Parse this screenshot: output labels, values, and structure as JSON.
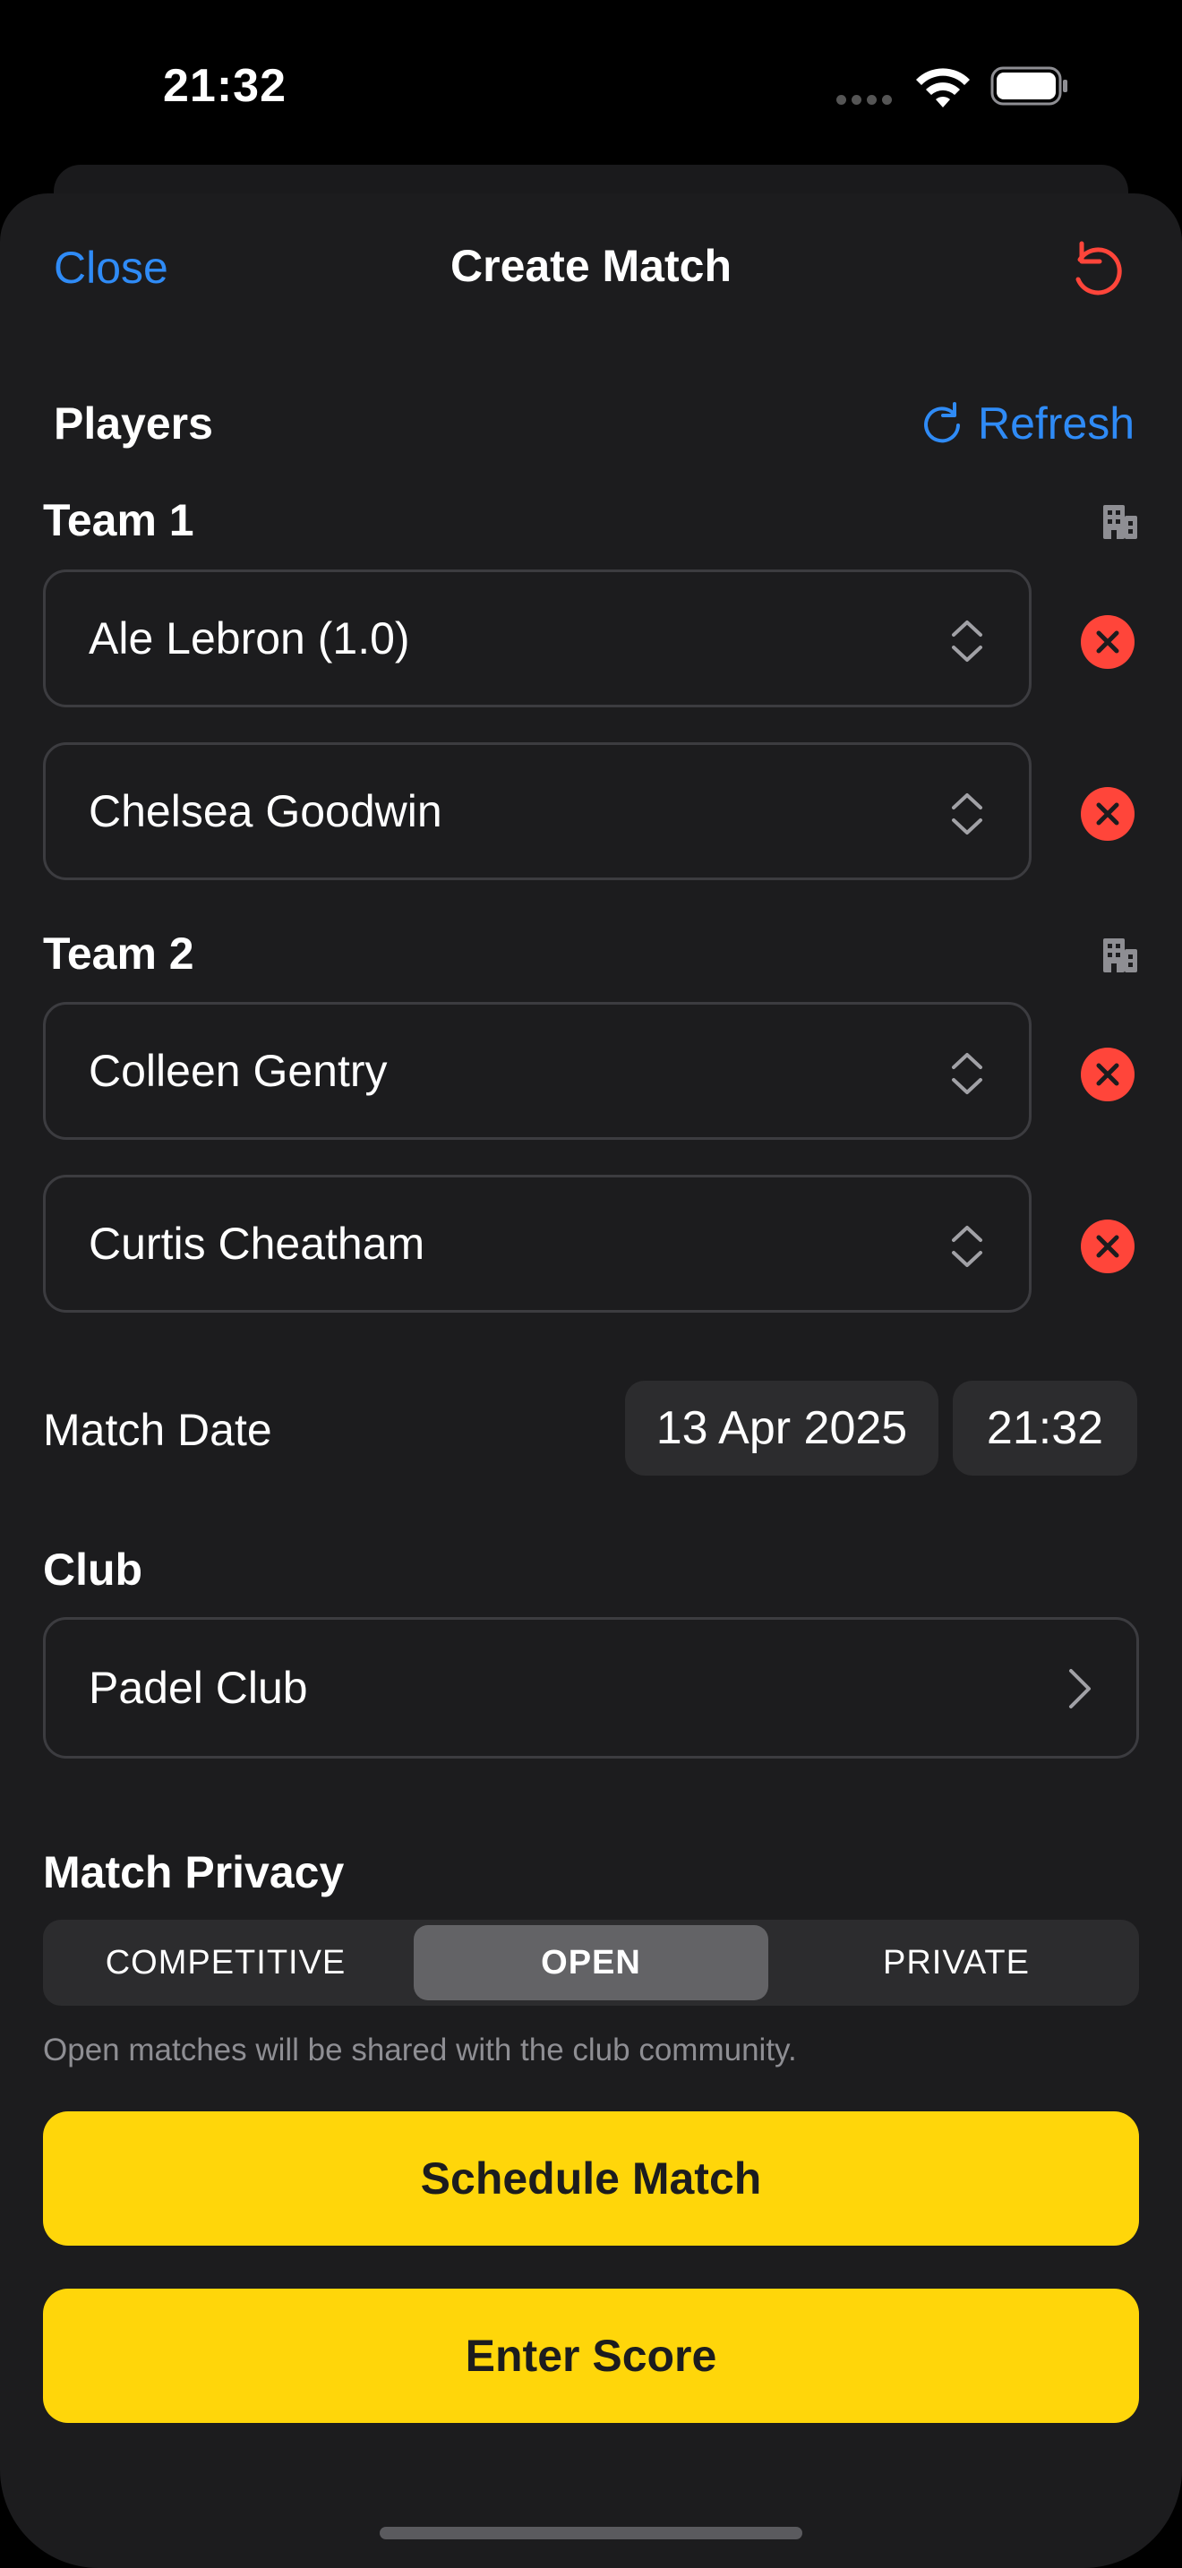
{
  "status_bar": {
    "time": "21:32"
  },
  "nav": {
    "close_label": "Close",
    "title": "Create Match",
    "reset_icon": "arrow-counterclockwise-icon"
  },
  "players": {
    "section_title": "Players",
    "refresh_label": "Refresh",
    "teams": [
      {
        "title": "Team 1",
        "players": [
          "Ale Lebron (1.0)",
          "Chelsea Goodwin"
        ]
      },
      {
        "title": "Team 2",
        "players": [
          "Colleen Gentry",
          "Curtis Cheatham"
        ]
      }
    ]
  },
  "match_date": {
    "label": "Match Date",
    "date": "13 Apr 2025",
    "time": "21:32"
  },
  "club": {
    "section_title": "Club",
    "value": "Padel Club"
  },
  "privacy": {
    "section_title": "Match Privacy",
    "options": [
      "COMPETITIVE",
      "OPEN",
      "PRIVATE"
    ],
    "selected": "OPEN",
    "note": "Open matches will be shared with the club community."
  },
  "actions": {
    "schedule_label": "Schedule Match",
    "enter_score_label": "Enter Score"
  },
  "colors": {
    "accent_blue": "#2f8bf6",
    "destructive_red": "#ff453a",
    "primary_yellow": "#ffd60a",
    "sheet_bg": "#1c1c1e"
  }
}
